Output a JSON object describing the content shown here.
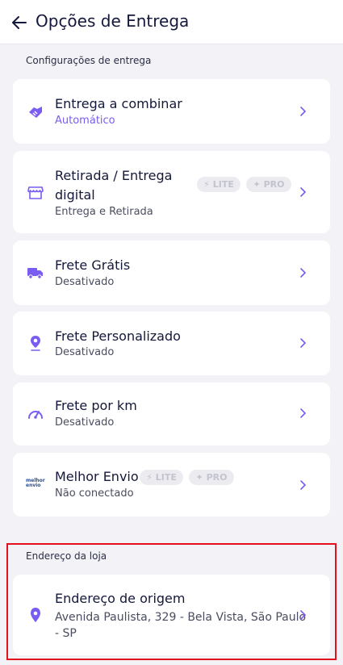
{
  "header": {
    "title": "Opções de Entrega"
  },
  "sections": {
    "delivery_settings_label": "Configurações de entrega",
    "store_address_label": "Endereço da loja"
  },
  "options": [
    {
      "title": "Entrega a combinar",
      "subtitle": "Automático",
      "icon": "handshake-icon"
    },
    {
      "title_line1": "Retirada / Entrega",
      "title_line2": "digital",
      "subtitle": "Entrega e Retirada",
      "icon": "store-icon",
      "badges": [
        "LITE",
        "PRO"
      ]
    },
    {
      "title": "Frete Grátis",
      "subtitle": "Desativado",
      "icon": "truck-icon"
    },
    {
      "title": "Frete Personalizado",
      "subtitle": "Desativado",
      "icon": "location-pin-icon"
    },
    {
      "title": "Frete por km",
      "subtitle": "Desativado",
      "icon": "speedometer-icon"
    },
    {
      "title": "Melhor Envio",
      "subtitle": "Não conectado",
      "icon": "melhor-envio-logo",
      "badges": [
        "LITE",
        "PRO"
      ],
      "logo_text": "melhor envio"
    }
  ],
  "origin": {
    "title": "Endereço de origem",
    "address_line1": "Avenida Paulista, 329 - Bela Vista, São Paulo",
    "address_line2": "- SP",
    "icon": "location-pin-icon"
  },
  "colors": {
    "accent": "#7b5cf0",
    "text": "#14183a",
    "highlight": "#e3101d",
    "badge_bg": "#ebebf0"
  }
}
